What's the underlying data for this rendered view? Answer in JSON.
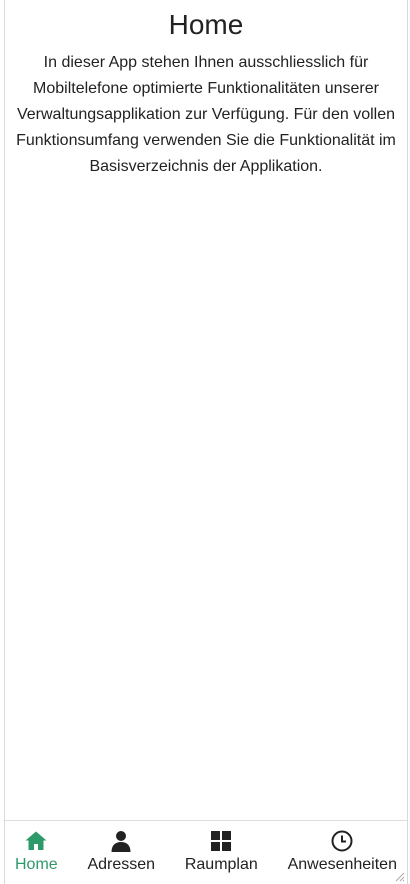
{
  "page": {
    "title": "Home",
    "intro": "In dieser App stehen Ihnen ausschliesslich für Mobiltelefone optimierte Funktionalitäten unserer Verwaltungsapplikation zur Verfügung. Für den vollen Funktionsumfang verwenden Sie die Funktionalität im Basisverzeichnis der Applikation."
  },
  "nav": {
    "items": [
      {
        "label": "Home",
        "icon": "home-icon",
        "active": true
      },
      {
        "label": "Adressen",
        "icon": "person-icon",
        "active": false
      },
      {
        "label": "Raumplan",
        "icon": "grid-icon",
        "active": false
      },
      {
        "label": "Anwesenheiten",
        "icon": "clock-icon",
        "active": false
      }
    ]
  },
  "colors": {
    "accent": "#2e9a6a",
    "text": "#222222",
    "border": "#dddddd"
  }
}
